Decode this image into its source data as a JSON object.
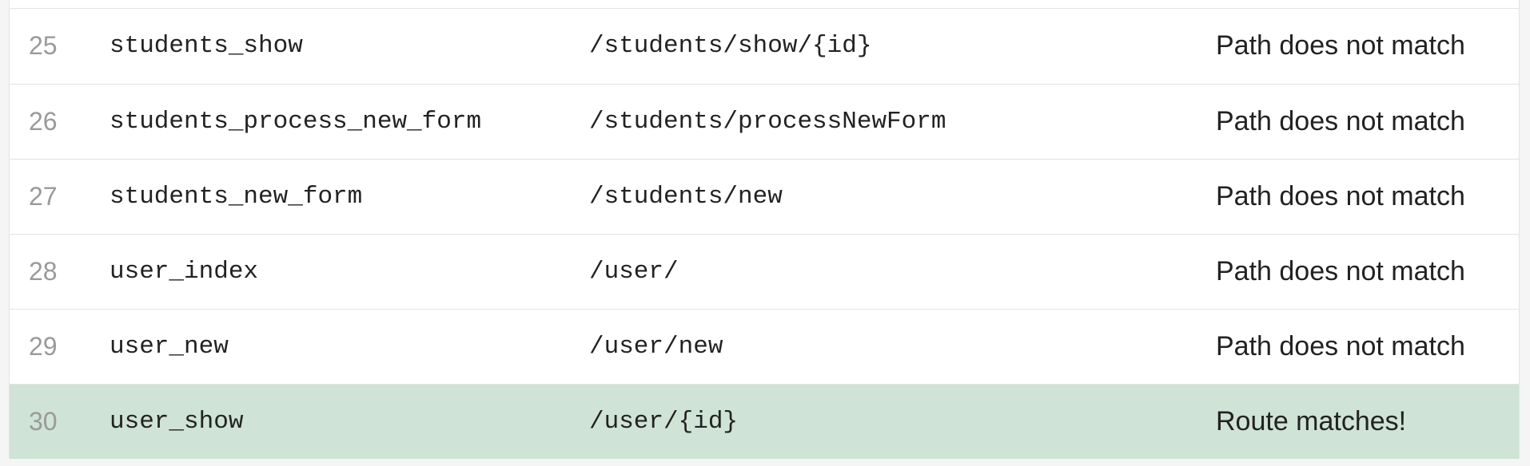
{
  "routes": [
    {
      "index": "25",
      "name": "students_show",
      "path": "/students/show/{id}",
      "status": "Path does not match",
      "matched": false
    },
    {
      "index": "26",
      "name": "students_process_new_form",
      "path": "/students/processNewForm",
      "status": "Path does not match",
      "matched": false
    },
    {
      "index": "27",
      "name": "students_new_form",
      "path": "/students/new",
      "status": "Path does not match",
      "matched": false
    },
    {
      "index": "28",
      "name": "user_index",
      "path": "/user/",
      "status": "Path does not match",
      "matched": false
    },
    {
      "index": "29",
      "name": "user_new",
      "path": "/user/new",
      "status": "Path does not match",
      "matched": false
    },
    {
      "index": "30",
      "name": "user_show",
      "path": "/user/{id}",
      "status": "Route matches!",
      "matched": true
    }
  ],
  "colors": {
    "matched_row_bg": "#cfe3d6",
    "index_text": "#9a9a9a",
    "border": "#e3e3e3"
  }
}
